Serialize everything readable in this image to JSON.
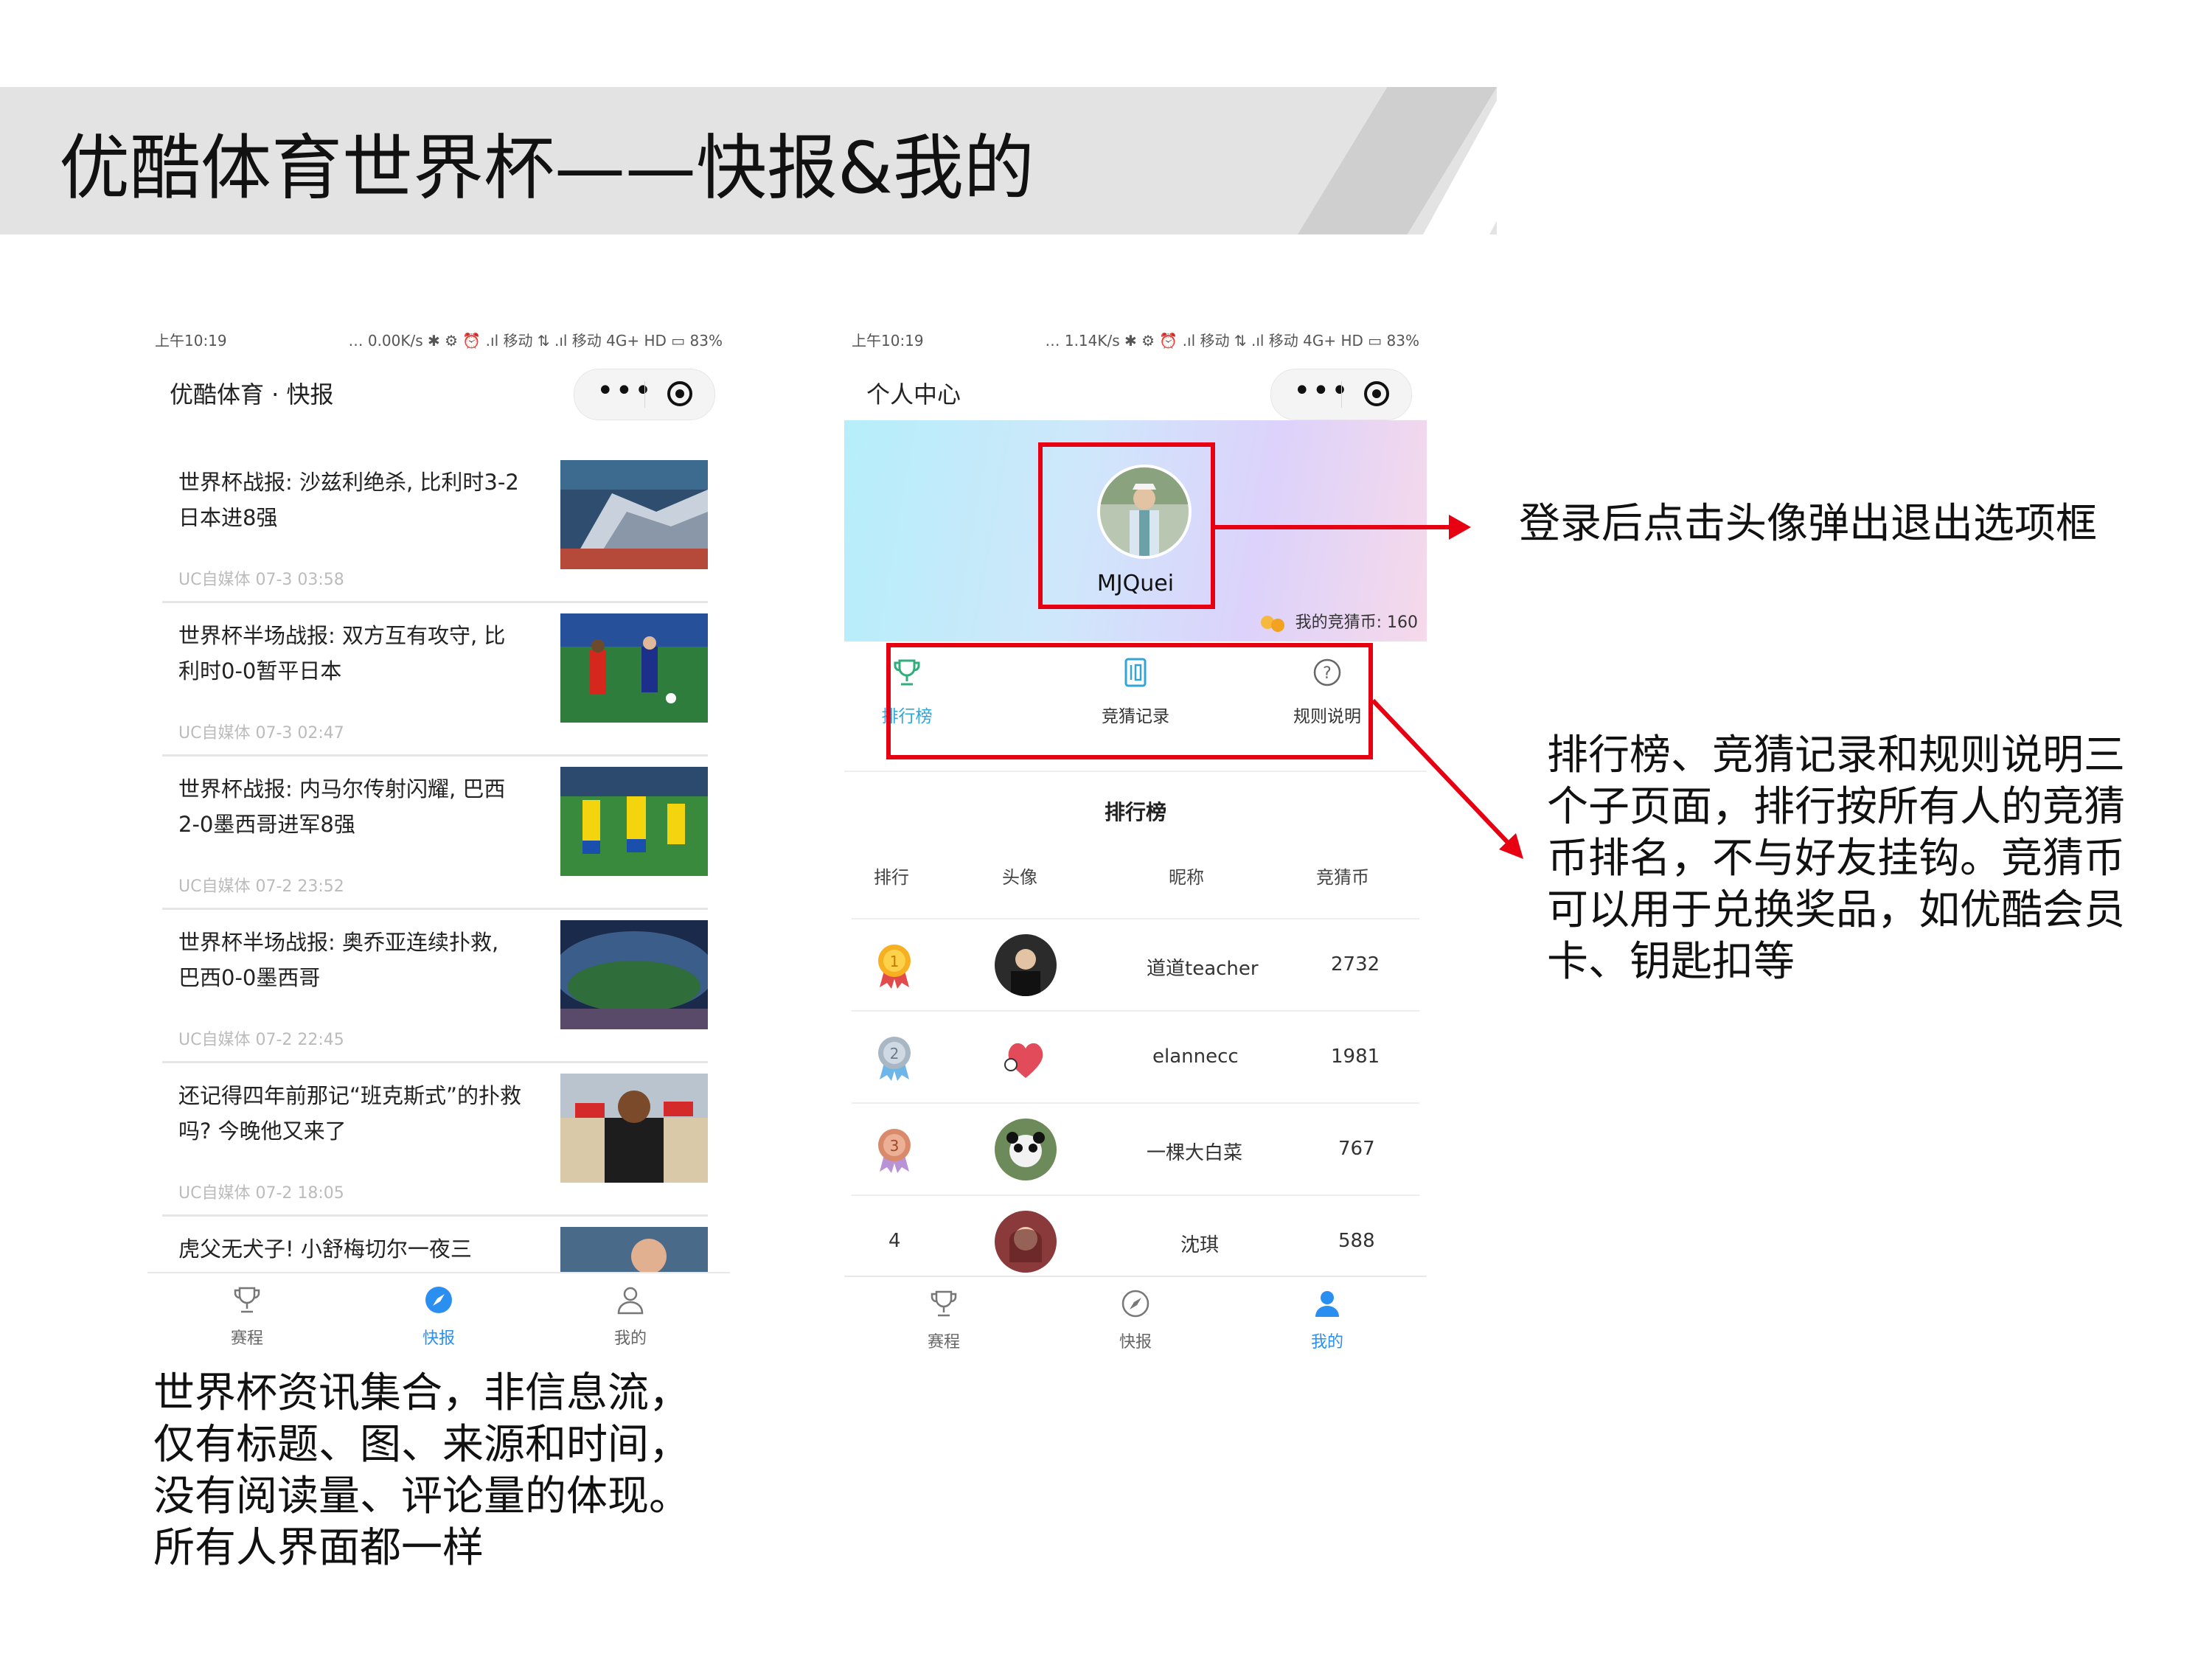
{
  "slide": {
    "title": "优酷体育世界杯——快报&我的"
  },
  "phone1": {
    "status": {
      "time": "上午10:19",
      "right": "… 0.00K/s ✱ ⚙ ⏰ .ıl 移动 ⇅ .ıl 移动 4G+ HD ▭ 83%"
    },
    "nav_title": "优酷体育 · 快报",
    "news": [
      {
        "title": "世界杯战报: 沙兹利绝杀, 比利时3-2日本进8强",
        "meta": "UC自媒体 07-3 03:58"
      },
      {
        "title": "世界杯半场战报: 双方互有攻守, 比利时0-0暂平日本",
        "meta": "UC自媒体 07-3 02:47"
      },
      {
        "title": "世界杯战报: 内马尔传射闪耀, 巴西2-0墨西哥进军8强",
        "meta": "UC自媒体 07-2 23:52"
      },
      {
        "title": "世界杯半场战报: 奥乔亚连续扑救, 巴西0-0墨西哥",
        "meta": "UC自媒体 07-2 22:45"
      },
      {
        "title": "还记得四年前那记“班克斯式”的扑救吗? 今晚他又来了",
        "meta": "UC自媒体 07-2 18:05"
      },
      {
        "title": "虎父无犬子! 小舒梅切尔一夜三",
        "meta": ""
      }
    ],
    "tabs": [
      "赛程",
      "快报",
      "我的"
    ]
  },
  "phone2": {
    "status": {
      "time": "上午10:19",
      "right": "… 1.14K/s ✱ ⚙ ⏰ .ıl 移动 ⇅ .ıl 移动 4G+ HD ▭ 83%"
    },
    "nav_title": "个人中心",
    "username": "MJQuei",
    "coins": "我的竞猜币: 160",
    "menu": [
      "排行榜",
      "竞猜记录",
      "规则说明"
    ],
    "ranking": {
      "heading": "排行榜",
      "columns": [
        "排行",
        "头像",
        "昵称",
        "竞猜币"
      ],
      "rows": [
        {
          "rank": "1",
          "name": "道道teacher",
          "coins": "2732"
        },
        {
          "rank": "2",
          "name": "elannecc",
          "coins": "1981"
        },
        {
          "rank": "3",
          "name": "一棵大白菜",
          "coins": "767"
        },
        {
          "rank": "4",
          "name": "沈琪",
          "coins": "588"
        }
      ]
    },
    "tabs": [
      "赛程",
      "快报",
      "我的"
    ]
  },
  "annotations": {
    "avatar_note": "登录后点击头像弹出退出选项框",
    "ranking_note": "排行榜、竞猜记录和规则说明三个子页面，排行按所有人的竞猜币排名，不与好友挂钩。竞猜币可以用于兑换奖品，如优酷会员卡、钥匙扣等",
    "news_note": "世界杯资讯集合，非信息流，仅有标题、图、来源和时间，没有阅读量、评论量的体现。所有人界面都一样"
  },
  "colors": {
    "accent_blue": "#2b8ff0",
    "highlight_red": "#e60012",
    "banner_gray": "#e3e3e3"
  }
}
